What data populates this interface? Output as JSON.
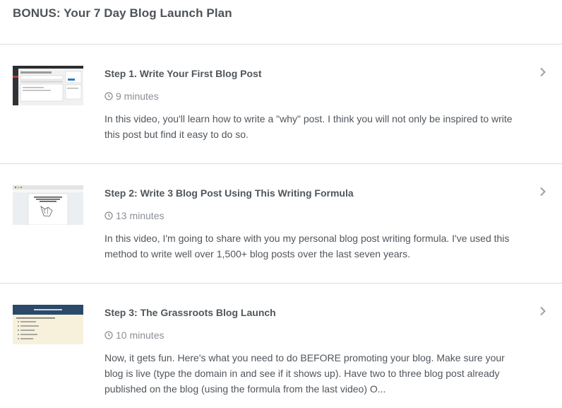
{
  "page": {
    "title": "BONUS: Your 7 Day Blog Launch Plan"
  },
  "lessons": [
    {
      "title": "Step 1. Write Your First Blog Post",
      "duration": "9 minutes",
      "description": "In this video, you'll learn how to write a \"why\" post. I think you will not only be inspired to write this post but find it easy to do so.",
      "thumbnail": "wordpress-editor-screenshot"
    },
    {
      "title": "Step 2: Write 3 Blog Post Using This Writing Formula",
      "duration": "13 minutes",
      "description": "In this video, I'm going to share with you my personal blog post writing formula. I've used this method to write well over 1,500+ blog posts over the last seven years.",
      "thumbnail": "google-doc-screenshot"
    },
    {
      "title": "Step 3: The Grassroots Blog Launch",
      "duration": "10 minutes",
      "description": "Now, it gets fun. Here's what you need to do BEFORE promoting your blog. Make sure your blog is live (type the domain in and see if it shows up). Have two to three blog post already published on the blog (using the formula from the last video) O...",
      "thumbnail": "blog-launch-plan-slide"
    }
  ],
  "icons": {
    "duration": "clock-icon",
    "open": "chevron-right-icon"
  },
  "colors": {
    "text": "#50565c",
    "muted": "#8a8f96",
    "divider": "#dcdde0"
  }
}
